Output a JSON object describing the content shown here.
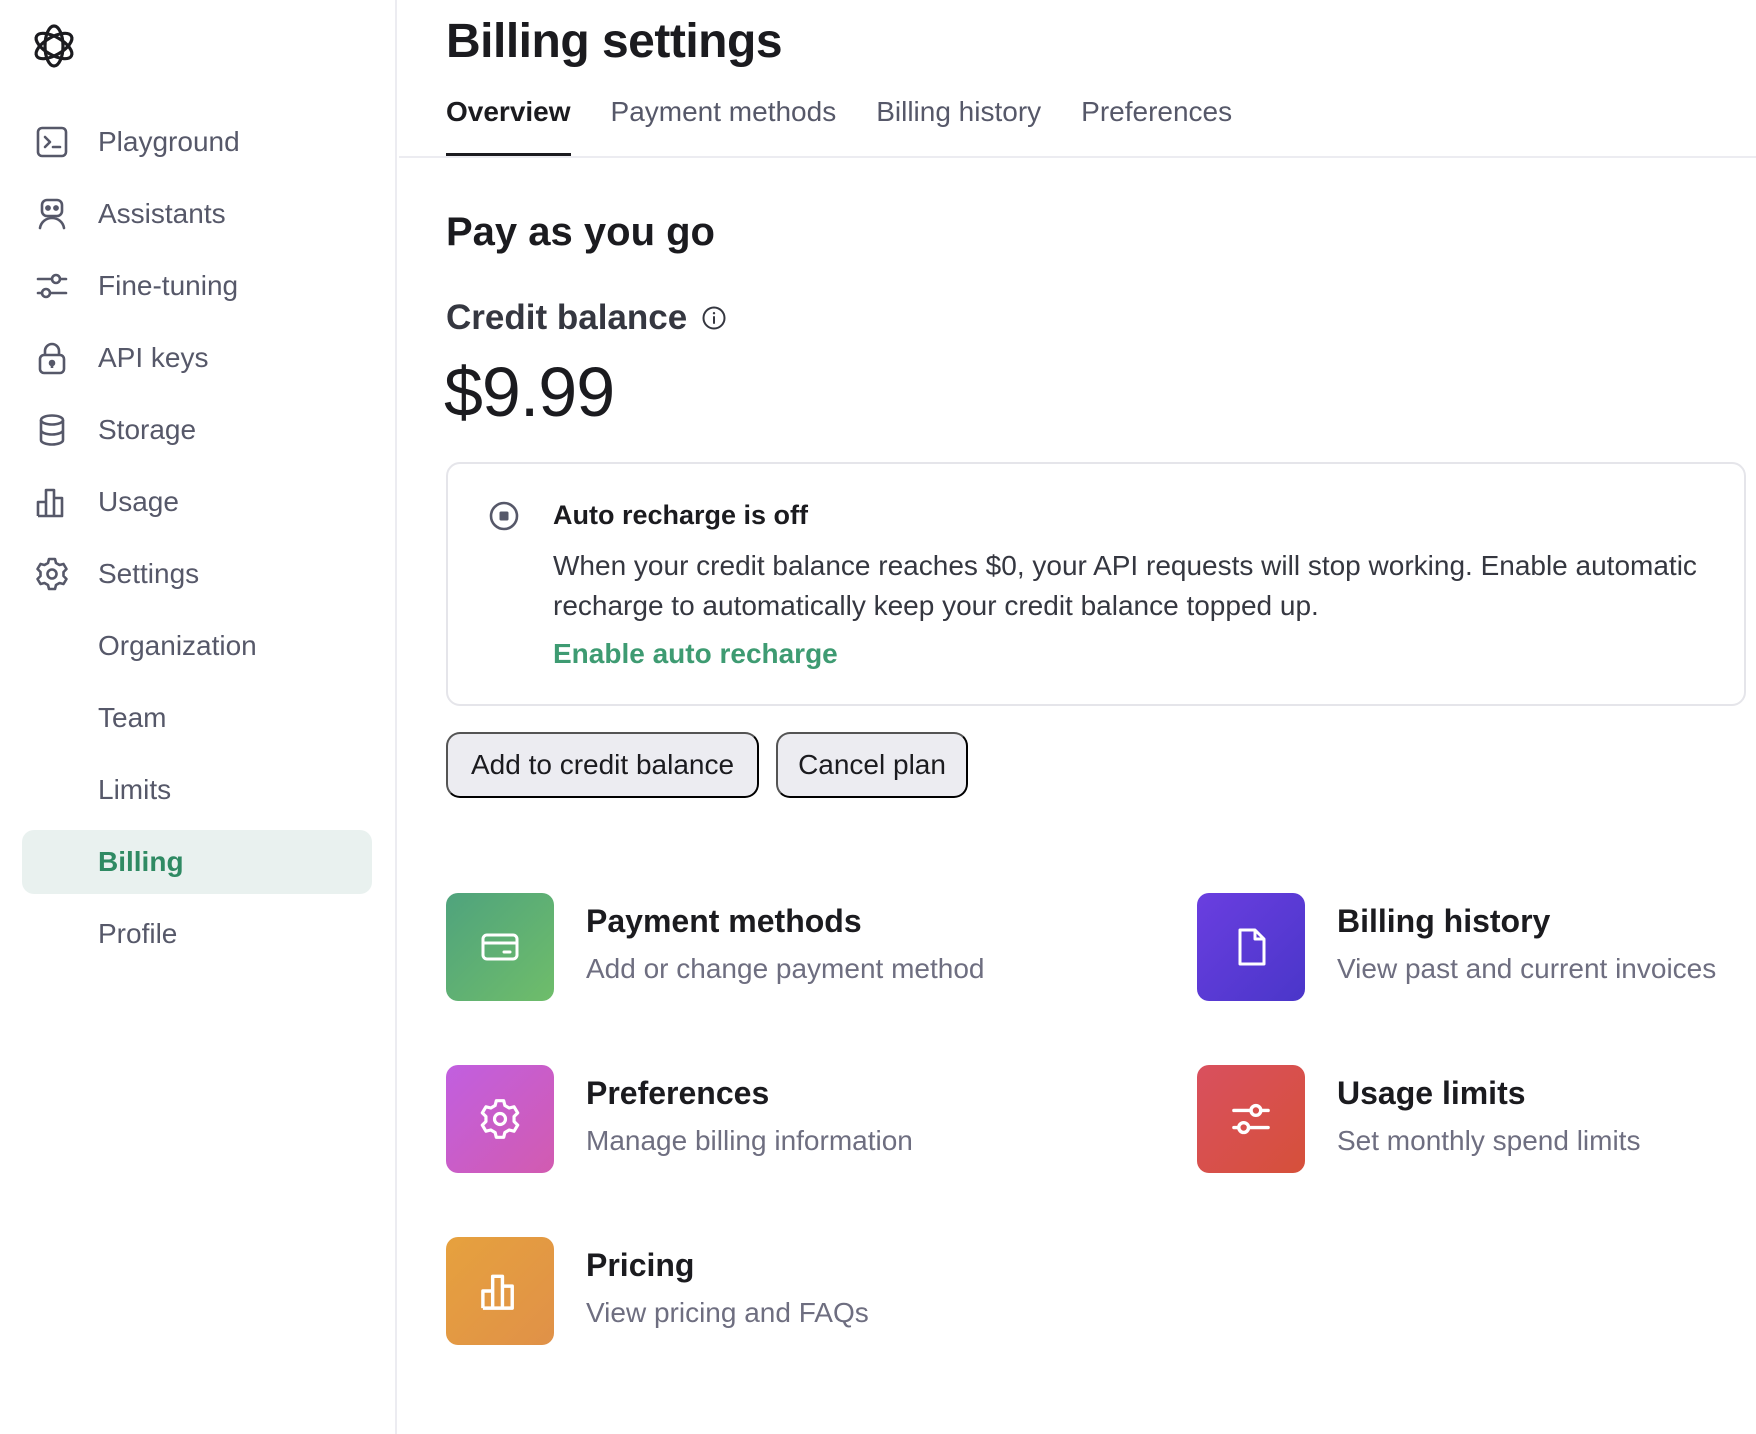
{
  "sidebar": {
    "logo": "openai-logo",
    "items": [
      {
        "label": "Playground",
        "icon": "terminal-icon"
      },
      {
        "label": "Assistants",
        "icon": "robot-icon"
      },
      {
        "label": "Fine-tuning",
        "icon": "sliders-icon"
      },
      {
        "label": "API keys",
        "icon": "lock-icon"
      },
      {
        "label": "Storage",
        "icon": "database-icon"
      },
      {
        "label": "Usage",
        "icon": "bar-chart-icon"
      },
      {
        "label": "Settings",
        "icon": "gear-icon"
      },
      {
        "label": "Organization"
      },
      {
        "label": "Team"
      },
      {
        "label": "Limits"
      },
      {
        "label": "Billing",
        "active": true
      },
      {
        "label": "Profile"
      }
    ]
  },
  "header": {
    "title": "Billing settings",
    "tabs": [
      {
        "label": "Overview",
        "active": true
      },
      {
        "label": "Payment methods"
      },
      {
        "label": "Billing history"
      },
      {
        "label": "Preferences"
      }
    ]
  },
  "plan": {
    "title": "Pay as you go",
    "credit_label": "Credit balance",
    "credit_amount": "$9.99"
  },
  "auto_recharge": {
    "title": "Auto recharge is off",
    "description": "When your credit balance reaches $0, your API requests will stop working. Enable automatic recharge to automatically keep your credit balance topped up.",
    "link": "Enable auto recharge"
  },
  "actions": {
    "add_credit": "Add to credit balance",
    "cancel_plan": "Cancel plan"
  },
  "cards": [
    {
      "title": "Payment methods",
      "subtitle": "Add or change payment method",
      "icon": "credit-card-icon",
      "color_from": "#4fa37d",
      "color_to": "#6fbd6a"
    },
    {
      "title": "Billing history",
      "subtitle": "View past and current invoices",
      "icon": "document-icon",
      "color_from": "#6a3ee0",
      "color_to": "#4a36c9"
    },
    {
      "title": "Preferences",
      "subtitle": "Manage billing information",
      "icon": "gear-icon",
      "color_from": "#c15fe0",
      "color_to": "#d25bb0"
    },
    {
      "title": "Usage limits",
      "subtitle": "Set monthly spend limits",
      "icon": "sliders-icon",
      "color_from": "#d9505e",
      "color_to": "#d6503a"
    },
    {
      "title": "Pricing",
      "subtitle": "View pricing and FAQs",
      "icon": "bar-chart-icon",
      "color_from": "#e6a13e",
      "color_to": "#e09148"
    }
  ],
  "colors": {
    "accent_green": "#2f8a63",
    "active_bg": "#e9f1ef",
    "link_green": "#3e9b72"
  }
}
